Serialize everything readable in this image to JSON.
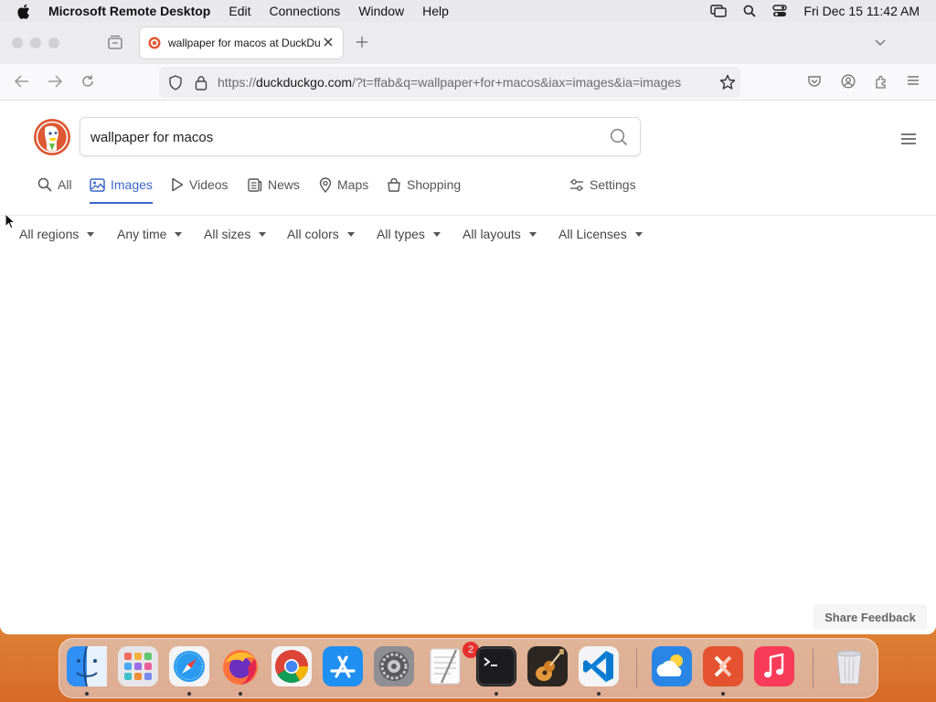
{
  "menubar": {
    "app_name": "Microsoft Remote Desktop",
    "menus": [
      "Edit",
      "Connections",
      "Window",
      "Help"
    ],
    "datetime": "Fri Dec 15  11:42 AM"
  },
  "browser": {
    "tab_title": "wallpaper for macos at DuckDuckGo",
    "url_prefix": "https://",
    "url_host": "duckduckgo.com",
    "url_path": "/?t=ffab&q=wallpaper+for+macos&iax=images&ia=images"
  },
  "page": {
    "search_query": "wallpaper for macos",
    "tabs": [
      {
        "label": "All",
        "icon": "search-icon"
      },
      {
        "label": "Images",
        "icon": "image-icon",
        "active": true
      },
      {
        "label": "Videos",
        "icon": "play-icon"
      },
      {
        "label": "News",
        "icon": "news-icon"
      },
      {
        "label": "Maps",
        "icon": "map-pin-icon"
      },
      {
        "label": "Shopping",
        "icon": "shopping-bag-icon"
      }
    ],
    "settings_label": "Settings",
    "filters": [
      "All regions",
      "Any time",
      "All sizes",
      "All colors",
      "All types",
      "All layouts",
      "All Licenses"
    ],
    "feedback_label": "Share Feedback"
  },
  "dock": {
    "apps": [
      "Finder",
      "Launchpad",
      "Safari",
      "Firefox",
      "Chrome",
      "App Store",
      "System Settings",
      "TextEdit",
      "Terminal",
      "GarageBand",
      "VS Code",
      "Weather",
      "Remote Desktop",
      "Music",
      "Trash"
    ],
    "settings_badge": "2"
  },
  "colors": {
    "accent": "#3b67c9",
    "badge": "#e6322f"
  }
}
